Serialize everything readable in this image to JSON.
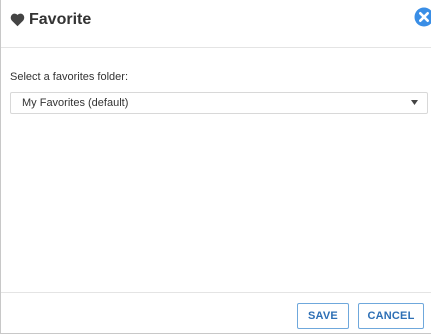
{
  "dialog": {
    "title": "Favorite",
    "title_icon": "heart-icon",
    "close_icon": "close-icon"
  },
  "form": {
    "label": "Select a favorites folder:",
    "selected_value": "My Favorites (default)",
    "arrow_icon": "dropdown-arrow-icon"
  },
  "footer": {
    "save_label": "SAVE",
    "cancel_label": "CANCEL"
  },
  "colors": {
    "accent": "#2d6fb5",
    "close_blue": "#3a8ee6",
    "button_border": "#6fa8dc",
    "heart": "#444444"
  }
}
